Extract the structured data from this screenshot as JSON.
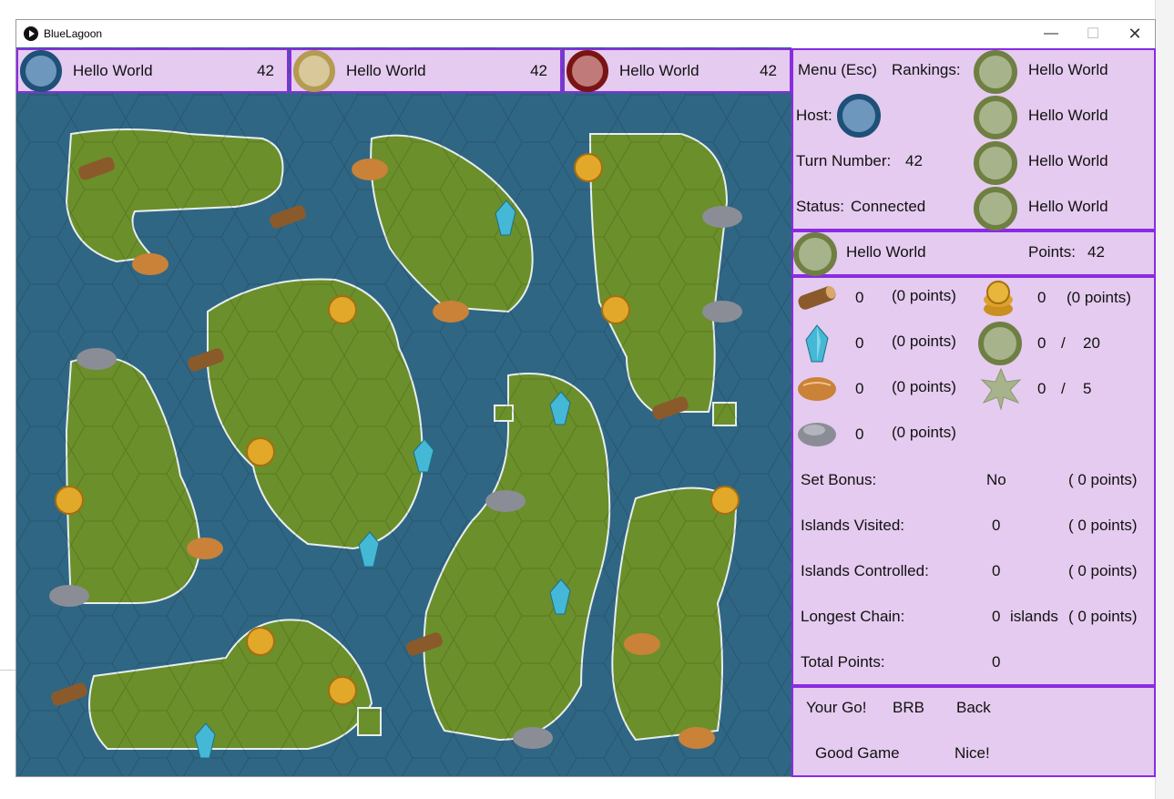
{
  "window": {
    "title": "BlueLagoon"
  },
  "players": [
    {
      "name": "Hello World",
      "score": "42",
      "ring": "#1e5078",
      "fill": "#6e97bd"
    },
    {
      "name": "Hello World",
      "score": "42",
      "ring": "#b49b50",
      "fill": "#d8c89a"
    },
    {
      "name": "Hello World",
      "score": "42",
      "ring": "#7a1414",
      "fill": "#c07a7a"
    }
  ],
  "info": {
    "menu_label": "Menu (Esc)",
    "rankings_label": "Rankings:",
    "host_label": "Host:",
    "turn_label": "Turn Number:",
    "turn_value": "42",
    "status_label": "Status:",
    "status_value": "Connected",
    "rankings": [
      "Hello World",
      "Hello World",
      "Hello World",
      "Hello World"
    ]
  },
  "me": {
    "name": "Hello World",
    "points_label": "Points:",
    "points_value": "42"
  },
  "resources": {
    "timber": {
      "count": "0",
      "points": "(0  points)"
    },
    "coconut": {
      "count": "0",
      "points": "(0  points)"
    },
    "statuette": {
      "count": "0",
      "points": "(0  points)"
    },
    "bamboo": {
      "count": "0",
      "points": "(0  points)"
    },
    "stone": {
      "count": "0",
      "points": "(0  points)"
    },
    "settlers": {
      "count": "0",
      "slash": "/",
      "max": "20"
    },
    "villages": {
      "count": "0",
      "slash": "/",
      "max": "5"
    }
  },
  "scores": {
    "set_bonus_label": "Set Bonus:",
    "set_bonus_value": "No",
    "set_bonus_points": "( 0  points)",
    "islands_visited_label": "Islands Visited:",
    "islands_visited_value": "0",
    "islands_visited_points": "( 0  points)",
    "islands_controlled_label": "Islands Controlled:",
    "islands_controlled_value": "0",
    "islands_controlled_points": "( 0  points)",
    "longest_chain_label": "Longest Chain:",
    "longest_chain_value": "0",
    "longest_chain_unit": "islands",
    "longest_chain_points": "( 0  points)",
    "total_label": "Total Points:",
    "total_value": "0"
  },
  "chat": {
    "your_go": "Your Go!",
    "brb": "BRB",
    "back": "Back",
    "good_game": "Good Game",
    "nice": "Nice!"
  },
  "colors": {
    "water": "#2f6684",
    "land": "#6b8f2a",
    "panel": "#e5cbef",
    "border": "#8a2be2"
  },
  "board_resources": [
    {
      "type": "timber"
    },
    {
      "type": "timber"
    },
    {
      "type": "bamboo"
    },
    {
      "type": "coconut"
    },
    {
      "type": "statuette"
    },
    {
      "type": "stone"
    }
  ]
}
